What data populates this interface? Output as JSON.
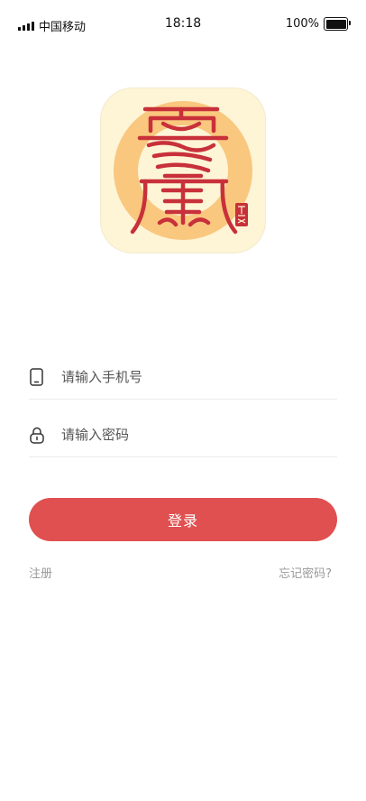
{
  "status_bar": {
    "carrier": "中国移动",
    "time": "18:18",
    "battery": "100%",
    "battery_level": 1.0
  },
  "logo": {
    "seal_text": "晴翔"
  },
  "form": {
    "phone_placeholder": "请输入手机号",
    "password_placeholder": "请输入密码",
    "login_label": "登录"
  },
  "links": {
    "register": "注册",
    "forgot_password": "忘记密码?"
  },
  "colors": {
    "accent": "#e05050",
    "logo_bg": "#fdf5d6",
    "logo_ring": "#f9c77e",
    "logo_glyph": "#c8303a"
  }
}
